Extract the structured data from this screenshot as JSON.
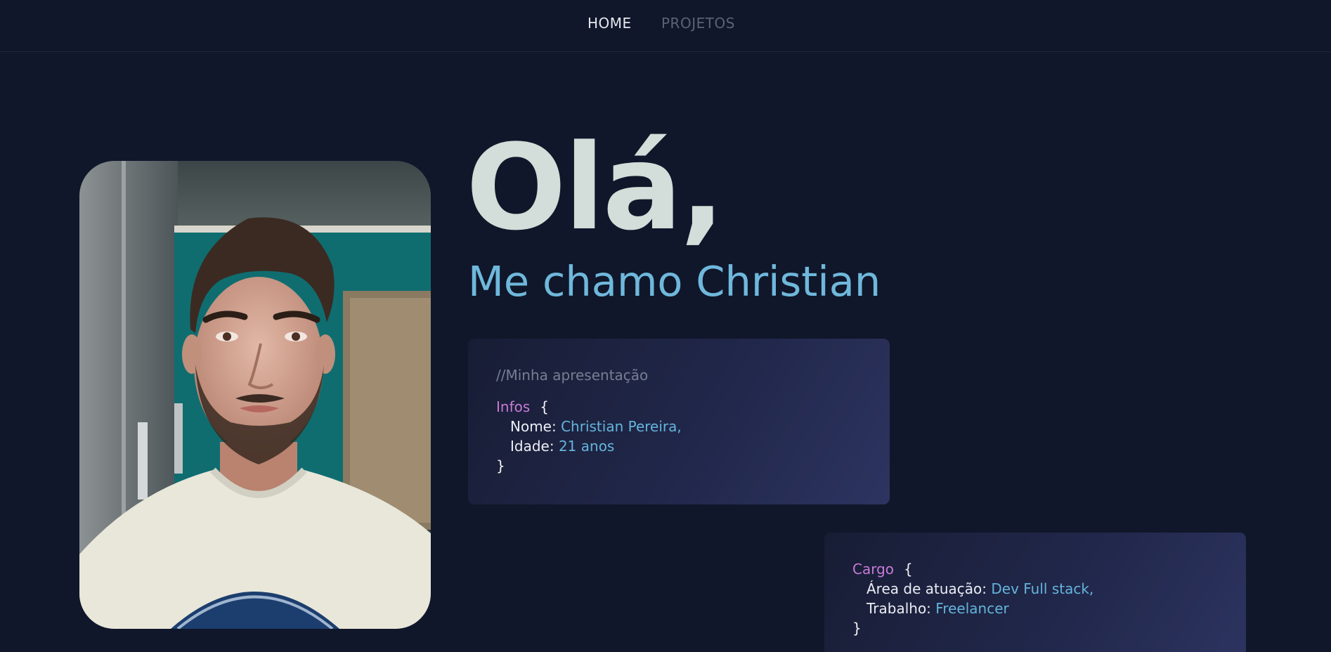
{
  "nav": {
    "home_label": "HOME",
    "projects_label": "PROJETOS"
  },
  "hero": {
    "greeting": "Olá,",
    "subtitle": "Me chamo Christian"
  },
  "info_card": {
    "comment": "//Minha apresentação",
    "object_name": "Infos",
    "open_brace": "{",
    "close_brace": "}",
    "fields": [
      {
        "key": "Nome:",
        "value": "Christian Pereira,"
      },
      {
        "key": "Idade:",
        "value": "21 anos"
      }
    ]
  },
  "cargo_card": {
    "object_name": "Cargo",
    "open_brace": "{",
    "close_brace": "}",
    "fields": [
      {
        "key": "Área de atuação:",
        "value": "Dev Full stack,"
      },
      {
        "key": "Trabalho:",
        "value": "Freelancer"
      }
    ]
  },
  "colors": {
    "background": "#10172a",
    "heading": "#d3ddd9",
    "accent_blue": "#6fb8dc",
    "code_key": "#c77ad6",
    "comment": "#777e92"
  }
}
